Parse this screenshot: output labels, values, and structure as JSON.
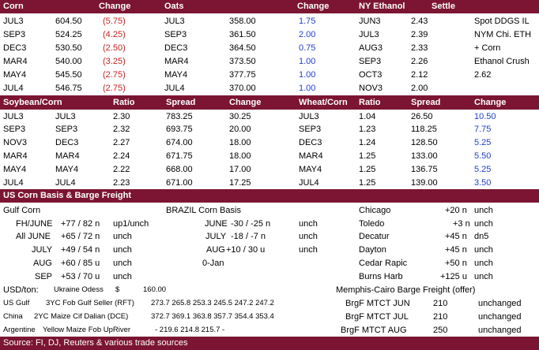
{
  "sec1": {
    "headers": [
      "Corn",
      "Change",
      "Oats",
      "Change",
      "NY Ethanol",
      "Settle"
    ],
    "rows": [
      {
        "c_m": "JUL3",
        "c_p": "604.50",
        "c_c": "(5.75)",
        "o_m": "JUL3",
        "o_p": "358.00",
        "o_c": "1.75",
        "e_m": "JUN3",
        "e_p": "2.43",
        "r": "Spot DDGS IL"
      },
      {
        "c_m": "SEP3",
        "c_p": "524.25",
        "c_c": "(4.25)",
        "o_m": "SEP3",
        "o_p": "361.50",
        "o_c": "2.00",
        "e_m": "JUL3",
        "e_p": "2.39",
        "r": "NYM Chi. ETH"
      },
      {
        "c_m": "DEC3",
        "c_p": "530.50",
        "c_c": "(2.50)",
        "o_m": "DEC3",
        "o_p": "364.50",
        "o_c": "0.75",
        "e_m": "AUG3",
        "e_p": "2.33",
        "r": "+ Corn"
      },
      {
        "c_m": "MAR4",
        "c_p": "540.00",
        "c_c": "(3.25)",
        "o_m": "MAR4",
        "o_p": "373.50",
        "o_c": "1.00",
        "e_m": "SEP3",
        "e_p": "2.26",
        "r": "Ethanol Crush"
      },
      {
        "c_m": "MAY4",
        "c_p": "545.50",
        "c_c": "(2.75)",
        "o_m": "MAY4",
        "o_p": "377.75",
        "o_c": "1.00",
        "e_m": "OCT3",
        "e_p": "2.12",
        "r": "2.62"
      },
      {
        "c_m": "JUL4",
        "c_p": "546.75",
        "c_c": "(2.75)",
        "o_m": "JUL4",
        "o_p": "370.00",
        "o_c": "1.00",
        "e_m": "NOV3",
        "e_p": "2.00",
        "r": ""
      }
    ]
  },
  "sec2": {
    "headers": [
      "Soybean/Corn",
      "Ratio",
      "Spread",
      "Change",
      "Wheat/Corn",
      "Ratio",
      "Spread",
      "Change"
    ],
    "rows": [
      {
        "a": "JUL3",
        "b": "JUL3",
        "r1": "2.30",
        "s1": "783.25",
        "c1": "30.25",
        "w": "JUL3",
        "r2": "1.04",
        "s2": "26.50",
        "c2": "10.50"
      },
      {
        "a": "SEP3",
        "b": "SEP3",
        "r1": "2.32",
        "s1": "693.75",
        "c1": "20.00",
        "w": "SEP3",
        "r2": "1.23",
        "s2": "118.25",
        "c2": "7.75"
      },
      {
        "a": "NOV3",
        "b": "DEC3",
        "r1": "2.27",
        "s1": "674.00",
        "c1": "18.00",
        "w": "DEC3",
        "r2": "1.24",
        "s2": "128.50",
        "c2": "5.25"
      },
      {
        "a": "MAR4",
        "b": "MAR4",
        "r1": "2.24",
        "s1": "671.75",
        "c1": "18.00",
        "w": "MAR4",
        "r2": "1.25",
        "s2": "133.00",
        "c2": "5.50"
      },
      {
        "a": "MAY4",
        "b": "MAY4",
        "r1": "2.22",
        "s1": "668.00",
        "c1": "17.00",
        "w": "MAY4",
        "r2": "1.25",
        "s2": "136.75",
        "c2": "5.25"
      },
      {
        "a": "JUL4",
        "b": "JUL4",
        "r1": "2.23",
        "s1": "671.00",
        "c1": "17.25",
        "w": "JUL4",
        "r2": "1.25",
        "s2": "139.00",
        "c2": "3.50"
      }
    ]
  },
  "sec3": {
    "header": "US Corn Basis & Barge Freight",
    "gulf_title": "Gulf Corn",
    "brazil_title": "BRAZIL Corn Basis",
    "gulf": [
      {
        "m": "FH/JUNE",
        "v": "+77 / 82 n",
        "c": "up1/unch"
      },
      {
        "m": "All JUNE",
        "v": "+65 / 72 n",
        "c": "unch"
      },
      {
        "m": "JULY",
        "v": "+49 / 54 n",
        "c": "unch"
      },
      {
        "m": "AUG",
        "v": "+60 / 85 u",
        "c": "unch"
      },
      {
        "m": "SEP",
        "v": "+53 / 70 u",
        "c": "unch"
      }
    ],
    "brazil": [
      {
        "m": "JUNE",
        "v": "-30 / -25 n",
        "c": "unch"
      },
      {
        "m": "JULY",
        "v": "-18 / -7 n",
        "c": "unch"
      },
      {
        "m": "AUG",
        "v": "+10 / 30 u",
        "c": "unch"
      },
      {
        "m": "0-Jan",
        "v": "",
        "c": ""
      }
    ],
    "cities": [
      {
        "n": "Chicago",
        "v": "+20 n",
        "c": "unch"
      },
      {
        "n": "Toledo",
        "v": "+3 n",
        "c": "unch"
      },
      {
        "n": "Decatur",
        "v": "+45 n",
        "c": "dn5"
      },
      {
        "n": "Dayton",
        "v": "+45 n",
        "c": "unch"
      },
      {
        "n": "Cedar Rapic",
        "v": "+50 n",
        "c": "unch"
      },
      {
        "n": "Burns Harb",
        "v": "+125 u",
        "c": "unch"
      }
    ],
    "usd_label": "USD/ton:",
    "ukraine_label": "Ukraine Odess",
    "ukraine_cur": "$",
    "ukraine_val": "160.00",
    "barge_title": "Memphis-Cairo Barge Freight (offer)",
    "fob": [
      {
        "o": "US Gulf",
        "d": "3YC Fob Gulf Seller (RFT)",
        "v": "273.7  265.8  253.3  245.5  247.2  247.2"
      },
      {
        "o": "China",
        "d": "2YC Maize Cif Dalian (DCE)",
        "v": "372.7  369.1  363.8  357.7  354.4  353.4"
      },
      {
        "o": "Argentine",
        "d": "Yellow Maize Fob UpRiver",
        "v": "-   219.6  214.8  215.7   -"
      }
    ],
    "barge": [
      {
        "n": "BrgF MTCT JUN",
        "v": "210",
        "c": "unchanged"
      },
      {
        "n": "BrgF MTCT JUL",
        "v": "210",
        "c": "unchanged"
      },
      {
        "n": "BrgF MTCT AUG",
        "v": "250",
        "c": "unchanged"
      }
    ]
  },
  "source": "Source: FI, DJ, Reuters & various trade sources"
}
